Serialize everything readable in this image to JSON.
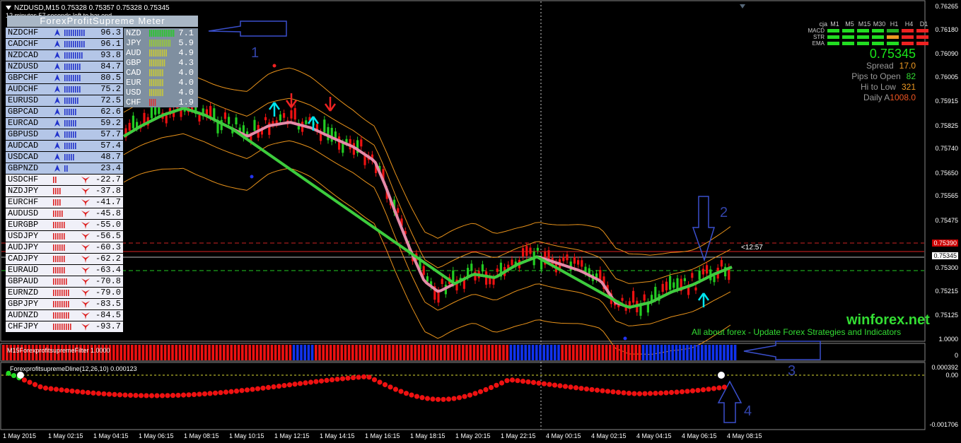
{
  "header": {
    "title": "NZDUSD,M15  0.75328 0.75357 0.75328 0.75345",
    "subtitle": "12 minutes 57 seconds left to bar end"
  },
  "meter": {
    "title": "ForexProfitSupreme Meter",
    "pairs": [
      {
        "name": "NZDCHF",
        "value": "96.3",
        "dir": "up"
      },
      {
        "name": "CADCHF",
        "value": "96.1",
        "dir": "up"
      },
      {
        "name": "NZDCAD",
        "value": "93.8",
        "dir": "up"
      },
      {
        "name": "NZDUSD",
        "value": "84.7",
        "dir": "up"
      },
      {
        "name": "GBPCHF",
        "value": "80.5",
        "dir": "up"
      },
      {
        "name": "AUDCHF",
        "value": "75.2",
        "dir": "up"
      },
      {
        "name": "EURUSD",
        "value": "72.5",
        "dir": "up"
      },
      {
        "name": "GBPCAD",
        "value": "62.6",
        "dir": "up"
      },
      {
        "name": "EURCAD",
        "value": "59.2",
        "dir": "up"
      },
      {
        "name": "GBPUSD",
        "value": "57.7",
        "dir": "up"
      },
      {
        "name": "AUDCAD",
        "value": "57.4",
        "dir": "up"
      },
      {
        "name": "USDCAD",
        "value": "48.7",
        "dir": "up"
      },
      {
        "name": "GBPNZD",
        "value": "23.4",
        "dir": "up"
      },
      {
        "name": "USDCHF",
        "value": "-22.7",
        "dir": "down"
      },
      {
        "name": "NZDJPY",
        "value": "-37.8",
        "dir": "down"
      },
      {
        "name": "EURCHF",
        "value": "-41.7",
        "dir": "down"
      },
      {
        "name": "AUDUSD",
        "value": "-45.8",
        "dir": "down"
      },
      {
        "name": "EURGBP",
        "value": "-55.0",
        "dir": "down"
      },
      {
        "name": "USDJPY",
        "value": "-56.5",
        "dir": "down"
      },
      {
        "name": "AUDJPY",
        "value": "-60.3",
        "dir": "down"
      },
      {
        "name": "CADJPY",
        "value": "-62.2",
        "dir": "down"
      },
      {
        "name": "EURAUD",
        "value": "-63.4",
        "dir": "down"
      },
      {
        "name": "GBPAUD",
        "value": "-70.8",
        "dir": "down"
      },
      {
        "name": "EURNZD",
        "value": "-79.0",
        "dir": "down"
      },
      {
        "name": "GBPJPY",
        "value": "-83.5",
        "dir": "down"
      },
      {
        "name": "AUDNZD",
        "value": "-84.5",
        "dir": "down"
      },
      {
        "name": "CHFJPY",
        "value": "-93.7",
        "dir": "down"
      }
    ],
    "currencies": [
      {
        "name": "NZD",
        "value": "7.1",
        "color": "#22cc22"
      },
      {
        "name": "JPY",
        "value": "5.9",
        "color": "#99cc33"
      },
      {
        "name": "AUD",
        "value": "4.9",
        "color": "#cccc33"
      },
      {
        "name": "GBP",
        "value": "4.3",
        "color": "#cccc33"
      },
      {
        "name": "CAD",
        "value": "4.0",
        "color": "#cccc33"
      },
      {
        "name": "EUR",
        "value": "4.0",
        "color": "#cccc33"
      },
      {
        "name": "USD",
        "value": "4.0",
        "color": "#cccc33"
      },
      {
        "name": "CHF",
        "value": "1.9",
        "color": "#dd3333"
      }
    ]
  },
  "mtf": {
    "headers": [
      "cja",
      "M1",
      "M5",
      "M15",
      "M30",
      "H1",
      "H4",
      "D1"
    ],
    "rows": [
      {
        "label": "MACD",
        "colors": [
          "#22dd22",
          "#22dd22",
          "#22dd22",
          "#22dd22",
          "#22aa22",
          "#ee2222",
          "#ee2222"
        ]
      },
      {
        "label": "STR",
        "colors": [
          "#22dd22",
          "#22dd22",
          "#22dd22",
          "#22dd22",
          "#ee9922",
          "#ee2222",
          "#ee2222"
        ]
      },
      {
        "label": "EMA",
        "colors": [
          "#22dd22",
          "#22dd22",
          "#22dd22",
          "#22dd22",
          "#22dd22",
          "#ee2222",
          "#ee2222"
        ]
      }
    ]
  },
  "info": {
    "price": "0.75345",
    "spread_label": "Spread",
    "spread": "17.0",
    "pips_label": "Pips to Open",
    "pips": "82",
    "hilow_label": "Hi to Low",
    "hilow": "321",
    "daily_label": "Daily A",
    "daily": "1008.0"
  },
  "price_axis": [
    "0.76265",
    "0.76180",
    "0.76090",
    "0.76005",
    "0.75915",
    "0.75825",
    "0.75740",
    "0.75650",
    "0.75565",
    "0.75475",
    "0.75390",
    "0.75345",
    "0.75300",
    "0.75215",
    "0.75125"
  ],
  "time_axis": [
    "1 May 2015",
    "1 May 02:15",
    "1 May 04:15",
    "1 May 06:15",
    "1 May 08:15",
    "1 May 10:15",
    "1 May 12:15",
    "1 May 14:15",
    "1 May 16:15",
    "1 May 18:15",
    "1 May 20:15",
    "1 May 22:15",
    "4 May 00:15",
    "4 May 02:15",
    "4 May 04:15",
    "4 May 06:15",
    "4 May 08:15"
  ],
  "countdown": "<12:57",
  "filter_panel": {
    "title": "M15ForexprofitsupremeFilter 1.0000",
    "axis_top": "1.0000",
    "axis_bottom": "0"
  },
  "dline_panel": {
    "title": "ForexprofitsupremeDline(12,26,10) 0.000123",
    "axis_top": "0.000392",
    "axis_mid": "0.00",
    "axis_bottom": "-0.001706"
  },
  "annotations": {
    "n1": "1",
    "n2": "2",
    "n3": "3",
    "n4": "4"
  },
  "branding": {
    "name": "winforex.net",
    "tagline": "All about forex - Update Forex Strategies and Indicators"
  }
}
